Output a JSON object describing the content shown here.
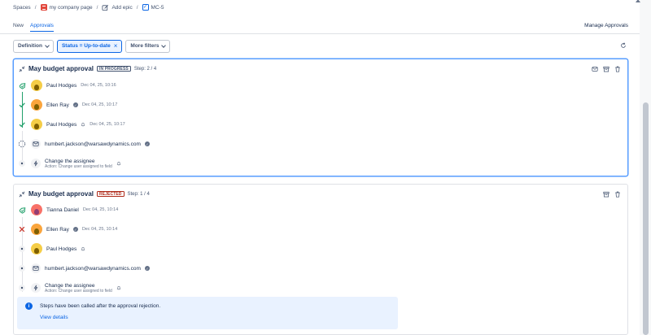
{
  "breadcrumb": {
    "spaces": "Spaces",
    "project": "my company page",
    "add_epic": "Add epic",
    "issue_key": "MC-5"
  },
  "tabs": [
    {
      "label": "New"
    },
    {
      "label": "Approvals"
    }
  ],
  "manage_approvals": "Manage Approvals",
  "filters": {
    "definition": "Definition",
    "status": "Status = Up-to-date",
    "more": "More filters"
  },
  "colors": {
    "accent": "#0c66e4",
    "success": "#22a06b",
    "danger": "#c9372c"
  },
  "cards": [
    {
      "title": "May budget approval",
      "status": "IN PROGRESS",
      "step": "Step: 2 / 4",
      "rows": [
        {
          "status_icon": "approval-icon",
          "name": "Paul Hodges",
          "time": "Dec 04, 25, 10:16"
        },
        {
          "status_icon": "check-icon",
          "name": "Ellen Ray",
          "time": "Dec 04, 25, 10:17"
        },
        {
          "status_icon": "check-icon",
          "name": "Paul Hodges",
          "time": "Dec 04, 25, 10:17"
        },
        {
          "status_icon": "pending-icon",
          "name": "humbert.jackson@warsawdynamics.com",
          "time": ""
        },
        {
          "status_icon": "dot-icon",
          "name": "Change the assignee",
          "sub": "Action: Change user assigned to field"
        }
      ]
    },
    {
      "title": "May budget approval",
      "status": "REJECTED",
      "step": "Step: 1 / 4",
      "rows": [
        {
          "status_icon": "approval-icon",
          "name": "Tianna Daniel",
          "time": "Dec 04, 25, 10:14"
        },
        {
          "status_icon": "reject-icon",
          "name": "Ellen Ray",
          "time": "Dec 04, 25, 10:14"
        },
        {
          "status_icon": "dot-icon",
          "name": "Paul Hodges",
          "time": ""
        },
        {
          "status_icon": "dot-icon",
          "name": "humbert.jackson@warsawdynamics.com",
          "time": ""
        },
        {
          "status_icon": "dot-icon",
          "name": "Change the assignee",
          "sub": "Action: Change user assigned to field"
        }
      ],
      "banner": {
        "text": "Steps have been called after the approval rejection.",
        "link": "View details"
      }
    }
  ]
}
